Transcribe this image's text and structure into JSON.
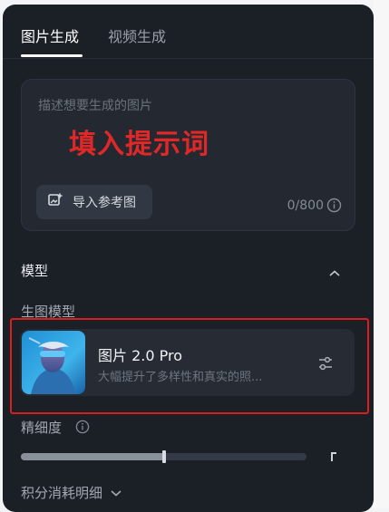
{
  "tabs": [
    {
      "label": "图片生成",
      "active": true
    },
    {
      "label": "视频生成",
      "active": false
    }
  ],
  "prompt": {
    "placeholder": "描述想要生成的图片",
    "annotation": "填入提示词",
    "char_count": "0/800",
    "reference_button_label": "导入参考图"
  },
  "model_section": {
    "title": "模型",
    "subsection_label": "生图模型",
    "model": {
      "name": "图片 2.0 Pro",
      "description": "大幅提升了多样性和真实的照..."
    }
  },
  "precision": {
    "label": "精细度",
    "value": 0.5
  },
  "credits": {
    "label": "积分消耗明细"
  },
  "colors": {
    "panel_bg": "#1b1f26",
    "annotation_red": "#e12828",
    "highlight_border": "#d91e1e"
  }
}
